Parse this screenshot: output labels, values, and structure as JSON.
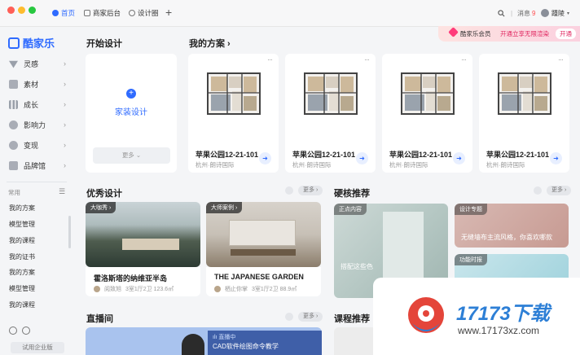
{
  "titlebar": {
    "tabs": [
      {
        "label": "首页",
        "active": true
      },
      {
        "label": "商家后台",
        "active": false
      },
      {
        "label": "设计圈",
        "active": false
      }
    ],
    "messages": "消息",
    "message_count": "9",
    "username": "踵陵"
  },
  "sidebar": {
    "logo": "酷家乐",
    "nav": [
      {
        "label": "灵感",
        "icon": "inspiration-icon"
      },
      {
        "label": "素材",
        "icon": "material-icon"
      },
      {
        "label": "成长",
        "icon": "growth-icon"
      },
      {
        "label": "影响力",
        "icon": "influence-icon"
      },
      {
        "label": "变现",
        "icon": "monetize-icon"
      },
      {
        "label": "品牌馆",
        "icon": "brand-icon"
      }
    ],
    "common_label": "常用",
    "common_items": [
      "我的方案",
      "模型管理",
      "我的课程",
      "我的证书",
      "我的方案",
      "模型管理",
      "我的课程"
    ],
    "trial_label": "试用企业版"
  },
  "promo": {
    "brand": "酷家乐会员",
    "text": "开通立享无限渲染",
    "button": "开通"
  },
  "start": {
    "title": "开始设计",
    "home_design": "家装设计",
    "more": "更多"
  },
  "plans": {
    "title": "我的方案 ›",
    "items": [
      {
        "name": "苹果公园12-21-101",
        "location": "杭州·朗诗国际"
      },
      {
        "name": "苹果公园12-21-101",
        "location": "杭州·朗诗国际"
      },
      {
        "name": "苹果公园12-21-101",
        "location": "杭州·朗诗国际"
      },
      {
        "name": "苹果公园12-21-101",
        "location": "杭州·朗诗国际"
      }
    ]
  },
  "excellent": {
    "title": "优秀设计",
    "more": "更多",
    "items": [
      {
        "badge": "大咖秀 ›",
        "name": "霍洛斯塔的纳维亚半岛",
        "author": "阅致旭",
        "meta": "3室1厅2卫 123.6㎡"
      },
      {
        "badge": "大师案例 ›",
        "name": "THE JAPANESE GARDEN",
        "author": "栖止你掌",
        "meta": "3室1厅2卫 88.9㎡"
      }
    ]
  },
  "hardcore": {
    "title": "硬核推荐",
    "more": "更多",
    "items": [
      {
        "tag": "正点内容",
        "caption": "搭配这些色"
      },
      {
        "tag": "设计专题",
        "caption": "无缝墙布主流风格，你喜欢哪款"
      },
      {
        "tag": "功能时报",
        "caption": ""
      }
    ]
  },
  "livestream": {
    "title": "直播间",
    "more": "更多",
    "status": "直播中",
    "caption": "CAD软件绘图命令教学"
  },
  "courses": {
    "title": "课程推荐"
  },
  "watermark": {
    "brand": "17173下载",
    "url": "www.17173xz.com"
  }
}
